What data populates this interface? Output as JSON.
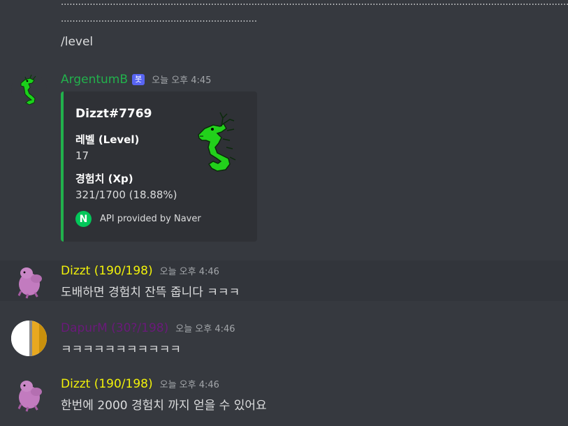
{
  "colors": {
    "background": "#36393f",
    "embed_bg": "#2f3136",
    "embed_accent": "#22b14c",
    "bot_name": "#22b14c",
    "dizzt_name": "#f1f10a",
    "dapur_name": "#6a1a7a",
    "bot_tag": "#5865f2"
  },
  "top_message": {
    "dots_line_1": "......................................................................................................................................................................................",
    "dots_line_2": "...................................................................................................................",
    "text": "/level"
  },
  "bot_message": {
    "username": "ArgentumB",
    "bot_tag": "봇",
    "timestamp": "오늘 오후 4:45",
    "avatar_icon": "green-dragon-icon",
    "embed": {
      "title": "Dizzt#7769",
      "fields": [
        {
          "name": "레벨 (Level)",
          "value": "17"
        },
        {
          "name": "경험치 (Xp)",
          "value": "321/1700 (18.88%)"
        }
      ],
      "thumbnail_icon": "green-dragon-icon",
      "footer_icon_letter": "N",
      "footer_text": "API provided by Naver"
    }
  },
  "messages": [
    {
      "username": "Dizzt (190/198)",
      "timestamp": "오늘 오후 4:46",
      "text": "도배하면 경험치 잔뜩 줍니다 ㅋㅋㅋ",
      "avatar_icon": "pink-creature-icon"
    },
    {
      "username": "DapurM (30?/198)",
      "timestamp": "오늘 오후 4:46",
      "text": "ㅋㅋㅋㅋㅋㅋㅋㅋㅋㅋㅋ",
      "avatar_icon": "white-gold-circle-icon"
    },
    {
      "username": "Dizzt (190/198)",
      "timestamp": "오늘 오후 4:46",
      "text": "한번에 2000 경험치 까지 얻을 수 있어요",
      "avatar_icon": "pink-creature-icon"
    }
  ]
}
